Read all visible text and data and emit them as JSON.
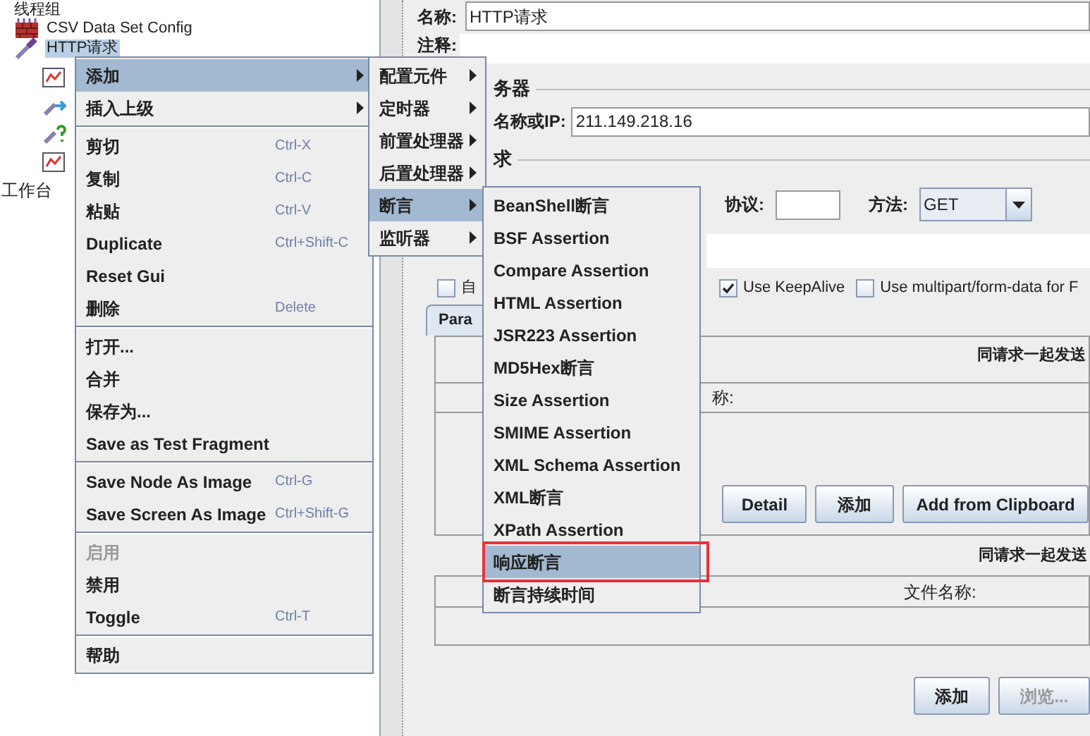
{
  "tree": {
    "top_label": "线程组",
    "items": [
      {
        "label": "CSV Data Set Config",
        "kind": "config",
        "selected": false
      },
      {
        "label": "HTTP请求",
        "kind": "sampler",
        "selected": true,
        "children": [
          {
            "kind": "listener"
          },
          {
            "kind": "preprocessor"
          },
          {
            "kind": "unknown"
          },
          {
            "kind": "listener"
          }
        ]
      }
    ],
    "workbench": "工作台"
  },
  "form": {
    "name_label": "名称:",
    "name_value": "HTTP请求",
    "comment_label": "注释:",
    "server_legend": "务器",
    "host_label": "名称或IP:",
    "host_value": "211.149.218.16",
    "request_legend": "求",
    "protocol_label": "协议:",
    "method_label": "方法:",
    "method_value": "GET",
    "checkboxes": [
      {
        "label": "自",
        "checked": false
      },
      {
        "label": "Use KeepAlive",
        "checked": true
      },
      {
        "label": "Use multipart/form-data for F",
        "checked": false
      }
    ],
    "tab": "Para",
    "params_caption": "同请求一起发送",
    "params_column": "称:",
    "param_buttons": [
      {
        "label": "Detail",
        "disabled": false
      },
      {
        "label": "添加",
        "disabled": false
      },
      {
        "label": "Add from Clipboard",
        "disabled": false
      }
    ],
    "files_caption": "同请求一起发送",
    "files_column": "文件名称:",
    "file_buttons": [
      {
        "label": "添加",
        "disabled": false
      },
      {
        "label": "浏览...",
        "disabled": true
      }
    ]
  },
  "context_menu": {
    "items": [
      {
        "kind": "item",
        "label": "添加",
        "submenu": true,
        "selected": true
      },
      {
        "kind": "item",
        "label": "插入上级",
        "submenu": true,
        "selected": false
      },
      {
        "kind": "separator"
      },
      {
        "kind": "item",
        "label": "剪切",
        "shortcut": "Ctrl-X",
        "selected": false
      },
      {
        "kind": "item",
        "label": "复制",
        "shortcut": "Ctrl-C",
        "selected": false
      },
      {
        "kind": "item",
        "label": "粘贴",
        "shortcut": "Ctrl-V",
        "selected": false
      },
      {
        "kind": "item",
        "label": "Duplicate",
        "shortcut": "Ctrl+Shift-C",
        "selected": false
      },
      {
        "kind": "item",
        "label": "Reset Gui",
        "selected": false
      },
      {
        "kind": "item",
        "label": "删除",
        "shortcut": "Delete",
        "selected": false
      },
      {
        "kind": "separator"
      },
      {
        "kind": "item",
        "label": "打开...",
        "selected": false
      },
      {
        "kind": "item",
        "label": "合并",
        "selected": false
      },
      {
        "kind": "item",
        "label": "保存为...",
        "selected": false
      },
      {
        "kind": "item",
        "label": "Save as Test Fragment",
        "selected": false
      },
      {
        "kind": "separator"
      },
      {
        "kind": "item",
        "label": "Save Node As Image",
        "shortcut": "Ctrl-G",
        "selected": false
      },
      {
        "kind": "item",
        "label": "Save Screen As Image",
        "shortcut": "Ctrl+Shift-G",
        "selected": false
      },
      {
        "kind": "separator"
      },
      {
        "kind": "item",
        "label": "启用",
        "selected": false,
        "disabled": true
      },
      {
        "kind": "item",
        "label": "禁用",
        "selected": false
      },
      {
        "kind": "item",
        "label": "Toggle",
        "shortcut": "Ctrl-T",
        "selected": false
      },
      {
        "kind": "separator"
      },
      {
        "kind": "item",
        "label": "帮助",
        "selected": false
      }
    ]
  },
  "add_submenu": {
    "items": [
      {
        "kind": "item",
        "label": "配置元件",
        "submenu": true,
        "selected": false
      },
      {
        "kind": "item",
        "label": "定时器",
        "submenu": true,
        "selected": false
      },
      {
        "kind": "item",
        "label": "前置处理器",
        "submenu": true,
        "selected": false
      },
      {
        "kind": "item",
        "label": "后置处理器",
        "submenu": true,
        "selected": false
      },
      {
        "kind": "item",
        "label": "断言",
        "submenu": true,
        "selected": true
      },
      {
        "kind": "item",
        "label": "监听器",
        "submenu": true,
        "selected": false
      }
    ]
  },
  "assertion_submenu": {
    "items": [
      {
        "kind": "item",
        "label": "BeanShell断言",
        "selected": false
      },
      {
        "kind": "item",
        "label": "BSF Assertion",
        "selected": false
      },
      {
        "kind": "item",
        "label": "Compare Assertion",
        "selected": false
      },
      {
        "kind": "item",
        "label": "HTML Assertion",
        "selected": false
      },
      {
        "kind": "item",
        "label": "JSR223 Assertion",
        "selected": false
      },
      {
        "kind": "item",
        "label": "MD5Hex断言",
        "selected": false
      },
      {
        "kind": "item",
        "label": "Size Assertion",
        "selected": false
      },
      {
        "kind": "item",
        "label": "SMIME Assertion",
        "selected": false
      },
      {
        "kind": "item",
        "label": "XML Schema Assertion",
        "selected": false
      },
      {
        "kind": "item",
        "label": "XML断言",
        "selected": false
      },
      {
        "kind": "item",
        "label": "XPath Assertion",
        "selected": false
      },
      {
        "kind": "item",
        "label": "响应断言",
        "selected": true,
        "annotated": true
      },
      {
        "kind": "item",
        "label": "断言持续时间",
        "selected": false
      }
    ]
  }
}
